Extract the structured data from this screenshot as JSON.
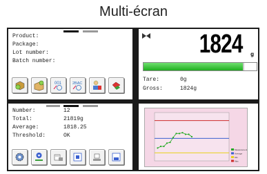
{
  "header": {
    "title": "Multi-écran"
  },
  "product_panel": {
    "fields": [
      "Product:",
      "Package:",
      "Lot number:",
      "Batch number:"
    ],
    "buttons": [
      {
        "icon": "product-cube-icon"
      },
      {
        "icon": "package-box-icon"
      },
      {
        "icon": "lot-number-icon",
        "text": "001"
      },
      {
        "icon": "batch-number-icon",
        "text": "2BAC"
      },
      {
        "icon": "operator-icon"
      },
      {
        "icon": "database-icon"
      }
    ]
  },
  "weighing_panel": {
    "reading": "1824",
    "unit": "g",
    "tare_label": "Tare:",
    "tare_value": "0g",
    "gross_label": "Gross:",
    "gross_value": "1824g",
    "load_fraction": 0.88
  },
  "statistics_panel": {
    "number_label": "Number:",
    "number_value": "12",
    "total_label": "Total:",
    "total_value": "21819g",
    "average_label": "Average:",
    "average_value": "1818.25",
    "threshold_label": "Threshold:",
    "threshold_value": "OK",
    "buttons": [
      {
        "icon": "settings-gear-icon"
      },
      {
        "icon": "checkweighing-icon"
      },
      {
        "icon": "print-scale-icon"
      },
      {
        "icon": "report-icon"
      },
      {
        "icon": "scale-config-icon"
      },
      {
        "icon": "save-icon"
      }
    ]
  },
  "chart_data": {
    "type": "line",
    "x": [
      1,
      2,
      3,
      4,
      5,
      6,
      7,
      8,
      9,
      10,
      11,
      12
    ],
    "series": [
      {
        "name": "Measurement",
        "values": [
          1806,
          1808,
          1808,
          1812,
          1813,
          1819,
          1824,
          1824,
          1825,
          1823,
          1823,
          1820
        ]
      },
      {
        "name": "Average",
        "values": [
          1818,
          1818,
          1818,
          1818,
          1818,
          1818,
          1818,
          1818,
          1818,
          1818,
          1818,
          1818
        ]
      },
      {
        "name": "Min",
        "values": [
          1800,
          1800,
          1800,
          1800,
          1800,
          1800,
          1800,
          1800,
          1800,
          1800,
          1800,
          1800
        ]
      },
      {
        "name": "Max",
        "values": [
          1840,
          1840,
          1840,
          1840,
          1840,
          1840,
          1840,
          1840,
          1840,
          1840,
          1840,
          1840
        ]
      }
    ],
    "legend_position": "right",
    "colors": {
      "measurement": "#22aa22",
      "average": "#3a5fcf",
      "min": "#e8d21a",
      "max": "#cc2a2a",
      "background": "#f5d7e6"
    }
  }
}
